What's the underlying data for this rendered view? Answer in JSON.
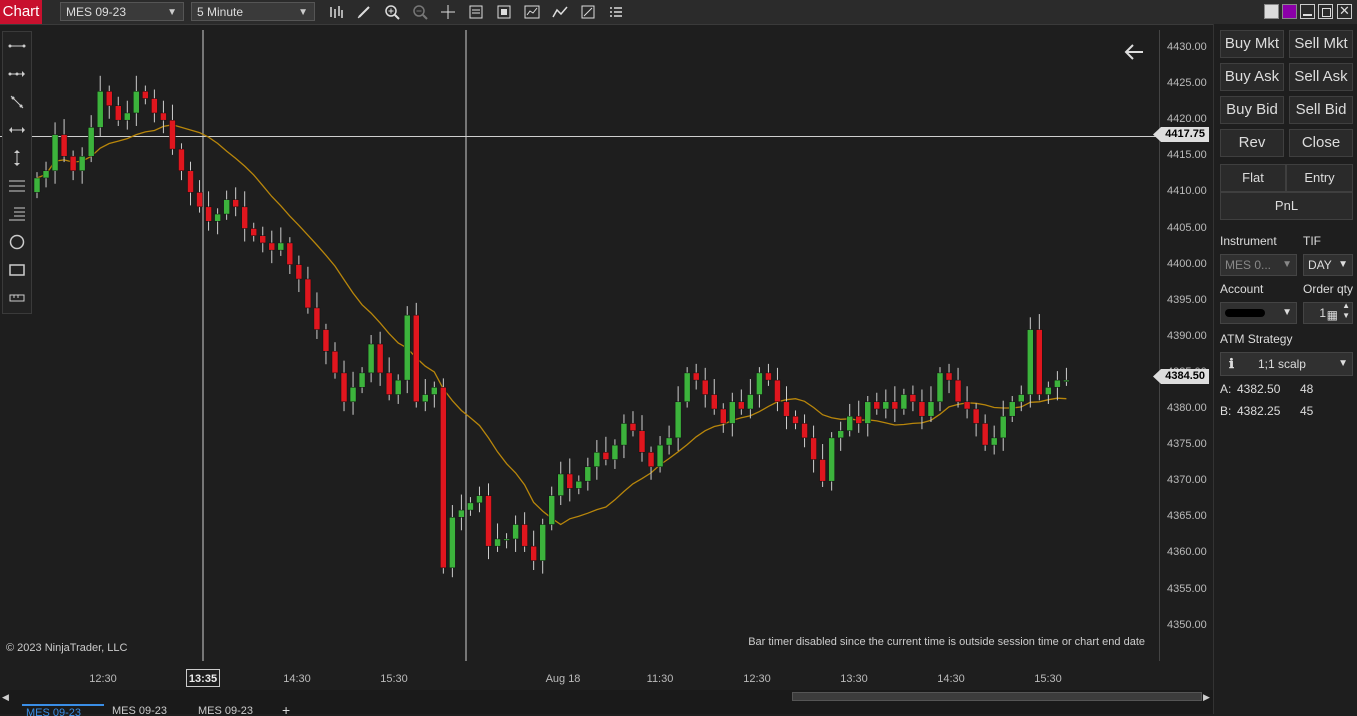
{
  "app": {
    "title": "Chart"
  },
  "toolbar": {
    "instrument": "MES 09-23",
    "interval": "5 Minute"
  },
  "chart": {
    "copyright": "© 2023 NinjaTrader, LLC",
    "bar_timer_message": "Bar timer disabled since the current time is outside session time or chart end date",
    "price_axis": [
      "4430.00",
      "4425.00",
      "4420.00",
      "4415.00",
      "4410.00",
      "4405.00",
      "4400.00",
      "4395.00",
      "4390.00",
      "4385.00",
      "4380.00",
      "4375.00",
      "4370.00",
      "4365.00",
      "4360.00",
      "4355.00",
      "4350.00"
    ],
    "time_axis": [
      "12:30",
      "14:30",
      "15:30",
      "Aug 18",
      "11:30",
      "12:30",
      "13:30",
      "14:30",
      "15:30"
    ],
    "crosshair_time": "13:35",
    "crosshair_price": "4417.75",
    "last_price": "4384.50",
    "colors": {
      "up": "#3cb33c",
      "down": "#e0161e",
      "ma": "#b8860b"
    }
  },
  "chart_data": {
    "type": "candlestick",
    "ylim": [
      4348,
      4432
    ],
    "closes": [
      4412,
      4413,
      4418,
      4415,
      4413,
      4415,
      4419,
      4424,
      4422,
      4420,
      4421,
      4424,
      4423,
      4421,
      4420,
      4416,
      4413,
      4410,
      4408,
      4406,
      4407,
      4409,
      4408,
      4405,
      4404,
      4403,
      4402,
      4403,
      4400,
      4398,
      4394,
      4391,
      4388,
      4385,
      4381,
      4383,
      4385,
      4389,
      4385,
      4382,
      4384,
      4393,
      4381,
      4382,
      4383,
      4358,
      4365,
      4366,
      4367,
      4368,
      4361,
      4362,
      4362,
      4364,
      4361,
      4359,
      4364,
      4368,
      4371,
      4369,
      4370,
      4372,
      4374,
      4373,
      4375,
      4378,
      4377,
      4374,
      4372,
      4375,
      4376,
      4381,
      4385,
      4384,
      4382,
      4380,
      4378,
      4381,
      4380,
      4382,
      4385,
      4384,
      4381,
      4379,
      4378,
      4376,
      4373,
      4370,
      4376,
      4377,
      4379,
      4378,
      4381,
      4380,
      4381,
      4380,
      4382,
      4381,
      4379,
      4381,
      4385,
      4384,
      4381,
      4380,
      4378,
      4375,
      4376,
      4379,
      4381,
      4382,
      4391,
      4382,
      4383,
      4384,
      4384
    ],
    "ma_note_free": true
  },
  "order_panel": {
    "buttons": [
      "Buy Mkt",
      "Sell Mkt",
      "Buy Ask",
      "Sell Ask",
      "Buy Bid",
      "Sell Bid",
      "Rev",
      "Close"
    ],
    "flat": "Flat",
    "entry": "Entry",
    "pnl": "PnL",
    "instrument_label": "Instrument",
    "instrument_value": "MES 0...",
    "tif_label": "TIF",
    "tif_value": "DAY",
    "account_label": "Account",
    "order_qty_label": "Order qty",
    "order_qty_value": "1",
    "atm_label": "ATM Strategy",
    "atm_value": "1;1 scalp",
    "ask_label": "A:",
    "ask_price": "4382.50",
    "ask_size": "48",
    "bid_label": "B:",
    "bid_price": "4382.25",
    "bid_size": "45"
  },
  "tabs": [
    "MES 09-23",
    "MES 09-23",
    "MES 09-23"
  ]
}
